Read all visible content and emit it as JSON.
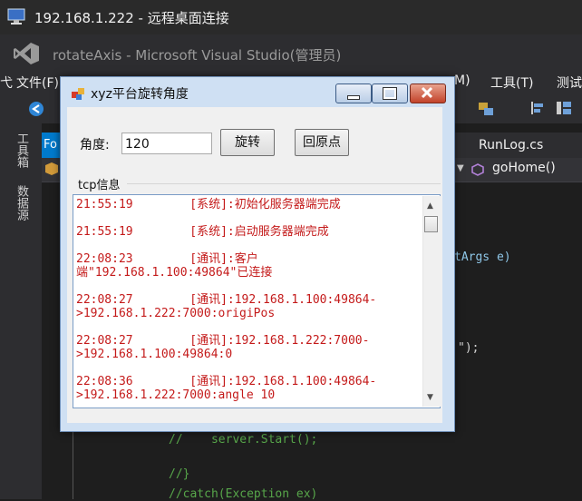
{
  "rdp": {
    "title": "192.168.1.222 - 远程桌面连接"
  },
  "vs": {
    "title": "rotateAxis - Microsoft Visual Studio(管理员)",
    "menu": {
      "left_cut": "弋",
      "file": "文件(F)",
      "m_cut": "M)",
      "tools": "工具(T)",
      "test_cut": "测试"
    },
    "left_panel": {
      "toolbox": "工具箱",
      "datasource": "数据源"
    },
    "tabs": {
      "active_cut": "Fo",
      "runlog": "RunLog.cs"
    },
    "nav": {
      "method": "goHome()"
    },
    "code": {
      "line_args": "tArgs e)",
      "line_paren": "\");",
      "line_start": "//    server.Start();",
      "line_brace": "//}",
      "line_catch": "//catch(Exception ex)"
    }
  },
  "dialog": {
    "title": "xyz平台旋转角度",
    "angle_label": "角度:",
    "angle_value": "120",
    "rotate_button": "旋转",
    "home_button": "回原点",
    "tcp_group": "tcp信息",
    "log_entries": [
      {
        "time": "21:55:19",
        "msg": "[系统]:初始化服务器端完成"
      },
      {
        "time": "21:55:19",
        "msg": "[系统]:启动服务器端完成"
      },
      {
        "time": "22:08:23",
        "msg": "[通讯]:客户",
        "cont": "端\"192.168.1.100:49864\"已连接"
      },
      {
        "time": "22:08:27",
        "msg": "[通讯]:192.168.1.100:49864-",
        "cont": ">192.168.1.222:7000:origiPos"
      },
      {
        "time": "22:08:27",
        "msg": "[通讯]:192.168.1.222:7000-",
        "cont": ">192.168.1.100:49864:0"
      },
      {
        "time": "22:08:36",
        "msg": "[通讯]:192.168.1.100:49864-",
        "cont": ">192.168.1.222:7000:angle 10"
      }
    ]
  },
  "colors": {
    "log_text": "#c41a1a",
    "vs_accent": "#007acc",
    "dialog_frame": "#cfe0f3"
  }
}
